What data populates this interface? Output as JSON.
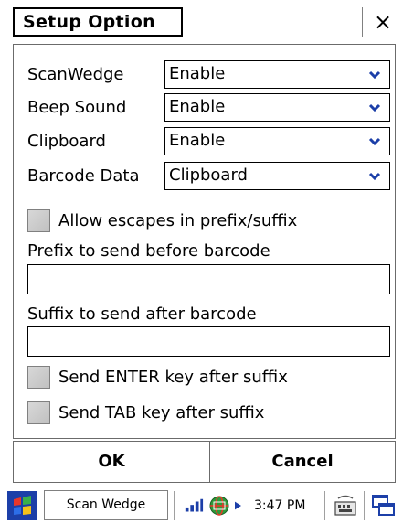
{
  "window": {
    "title": "Setup  Option",
    "close_label": "×"
  },
  "settings": [
    {
      "label": "ScanWedge",
      "value": "Enable"
    },
    {
      "label": "Beep Sound",
      "value": "Enable"
    },
    {
      "label": "Clipboard",
      "value": "Enable"
    },
    {
      "label": "Barcode Data",
      "value": "Clipboard"
    }
  ],
  "options": {
    "allow_escapes": {
      "label": "Allow escapes in prefix/suffix",
      "checked": false
    },
    "prefix": {
      "label": "Prefix to send before barcode",
      "value": ""
    },
    "suffix": {
      "label": "Suffix to send after barcode",
      "value": ""
    },
    "send_enter": {
      "label": "Send ENTER key after suffix",
      "checked": false
    },
    "send_tab": {
      "label": "Send TAB key after suffix",
      "checked": false
    }
  },
  "buttons": {
    "ok": "OK",
    "cancel": "Cancel"
  },
  "taskbar": {
    "app_label": "Scan Wedge",
    "time": "3:47 PM",
    "icons": [
      "start-icon",
      "antenna-signal-icon",
      "network-globe-icon",
      "keyboard-icon",
      "window-switch-icon"
    ]
  },
  "colors": {
    "accent_blue": "#1c3fa8",
    "checkbox_gray": "#c8c8c8"
  }
}
